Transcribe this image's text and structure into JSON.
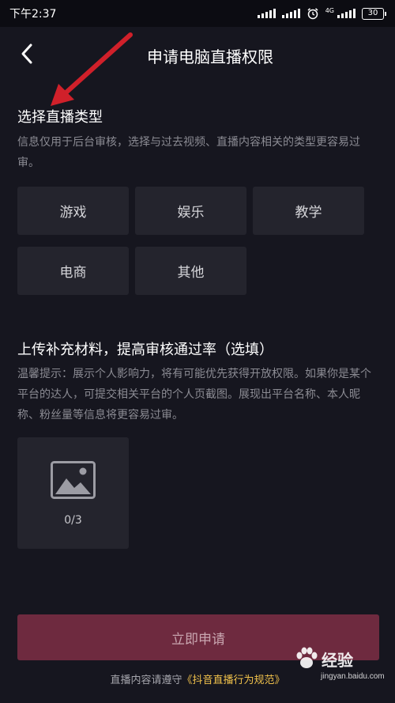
{
  "status_bar": {
    "time": "下午2:37",
    "network": "4G",
    "battery": "30",
    "icons": [
      "signal-icon",
      "alarm-icon",
      "battery-icon"
    ]
  },
  "header": {
    "back_icon": "chevron-left-icon",
    "title": "申请电脑直播权限"
  },
  "live_type": {
    "title": "选择直播类型",
    "description": "信息仅用于后台审核，选择与过去视频、直播内容相关的类型更容易过审。",
    "options": [
      "游戏",
      "娱乐",
      "教学",
      "电商",
      "其他"
    ]
  },
  "materials": {
    "title": "上传补充材料，提高审核通过率（选填）",
    "description": "温馨提示：展示个人影响力，将有可能优先获得开放权限。如果你是某个平台的达人，可提交相关平台的个人页截图。展现出平台名称、本人昵称、粉丝量等信息将更容易过审。",
    "upload_icon": "image-icon",
    "upload_count": "0/3"
  },
  "submit_label": "立即申请",
  "footer": {
    "prefix": "直播内容请遵守",
    "link": "《抖音直播行为规范》"
  },
  "watermark": {
    "brand": "经验",
    "url": "jingyan.baidu.com"
  },
  "colors": {
    "background": "#16161f",
    "chip": "#24242d",
    "submit": "#6e2a3f",
    "link": "#f0c14b",
    "annotation_arrow": "#d0202a"
  }
}
